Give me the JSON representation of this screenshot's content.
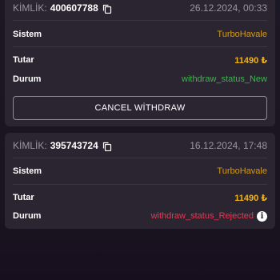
{
  "transactions": [
    {
      "id_label": "KİMLİK:",
      "id_value": "400607788",
      "date": "26.12.2024, 00:33",
      "system_label": "Sistem",
      "system_value": "TurboHavale",
      "amount_label": "Tutar",
      "amount_value": "11490 ₺",
      "status_label": "Durum",
      "status_value": "withdraw_status_New",
      "cancel_label": "CANCEL WİTHDRAW"
    },
    {
      "id_label": "KİMLİK:",
      "id_value": "395743724",
      "date": "16.12.2024, 17:48",
      "system_label": "Sistem",
      "system_value": "TurboHavale",
      "amount_label": "Tutar",
      "amount_value": "11490 ₺",
      "status_label": "Durum",
      "status_value": "withdraw_status_Rejected",
      "info_glyph": "i"
    }
  ],
  "colors": {
    "card_bg": "#2a2531",
    "provider": "#d29a1c",
    "amount": "#f0b21a",
    "status_new": "#3bb54a",
    "status_rejected": "#f0344f"
  },
  "icons": {
    "copy": "copy-icon",
    "info": "info-icon"
  }
}
